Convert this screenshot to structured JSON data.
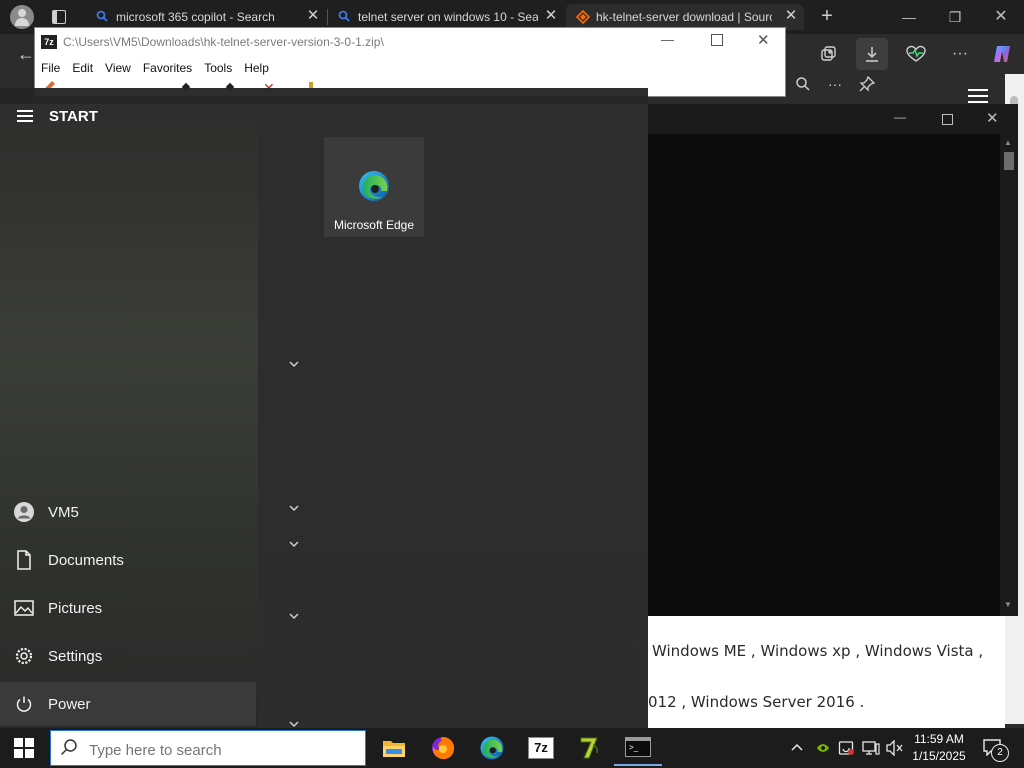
{
  "browser": {
    "tabs": [
      {
        "title": "microsoft 365 copilot - Search"
      },
      {
        "title": "telnet server on windows 10 - Sea"
      },
      {
        "title": "hk-telnet-server download | Sourc"
      }
    ],
    "new_tab_icon": "plus-icon",
    "window_controls": [
      "minimize-icon",
      "restore-icon",
      "close-icon"
    ],
    "toolbar_icons": [
      "back-arrow-icon",
      "collections-icon",
      "download-icon",
      "heartbeat-icon",
      "more-icon",
      "copilot-icon"
    ],
    "page_icons": [
      "search-icon",
      "more-icon",
      "pin-icon",
      "hamburger-icon"
    ],
    "page_text": {
      "line1": "Windows ME , Windows xp , Windows Vista ,",
      "line2": "012 , Windows Server 2016 ."
    }
  },
  "zip_window": {
    "title": "C:\\Users\\VM5\\Downloads\\hk-telnet-server-version-3-0-1.zip\\",
    "menu": [
      "File",
      "Edit",
      "View",
      "Favorites",
      "Tools",
      "Help"
    ]
  },
  "cmd_window": {},
  "start_menu": {
    "header": "START",
    "pinned_tile": {
      "label": "Microsoft Edge",
      "icon": "edge-icon"
    },
    "items": [
      {
        "label": "VM5",
        "icon": "user-icon"
      },
      {
        "label": "Documents",
        "icon": "document-icon"
      },
      {
        "label": "Pictures",
        "icon": "pictures-icon"
      },
      {
        "label": "Settings",
        "icon": "gear-icon"
      },
      {
        "label": "Power",
        "icon": "power-icon"
      }
    ]
  },
  "taskbar": {
    "search_placeholder": "Type here to search",
    "apps": [
      "file-explorer-icon",
      "firefox-icon",
      "edge-icon",
      "7zip-icon",
      "7zip-alt-icon",
      "cmd-icon"
    ],
    "clock_time": "11:59 AM",
    "clock_date": "1/15/2025",
    "notification_count": "2"
  },
  "colors": {
    "accent": "#2b79d6",
    "taskbar": "#1c1c1c",
    "start_bg": "#262626"
  }
}
